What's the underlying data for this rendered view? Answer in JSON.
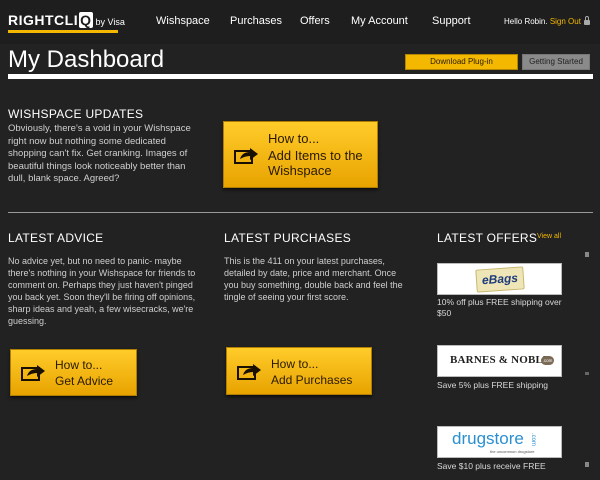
{
  "brand": {
    "logo_main": "RIGHTCLI",
    "logo_q": "Q",
    "logo_by": "by Visa"
  },
  "nav": {
    "items": [
      "Wishspace",
      "Purchases",
      "Offers",
      "My Account",
      "Support"
    ]
  },
  "user": {
    "greeting": "Hello Robin.",
    "sign_out": "Sign Out"
  },
  "header": {
    "title": "My Dashboard",
    "download_plugin": "Download Plug-in",
    "getting_started": "Getting Started"
  },
  "wishspace": {
    "heading": "WISHSPACE UPDATES",
    "body": "Obviously, there's a void in your Wishspace right now but nothing some dedicated shopping can't fix. Get cranking. Images of beautiful things look noticeably better than dull, blank space. Agreed?",
    "cta_line1": "How to...",
    "cta_line2": "Add Items to the Wishspace"
  },
  "advice": {
    "heading": "LATEST ADVICE",
    "body": "No advice yet, but no need to panic- maybe there's nothing in your Wishspace for friends to comment on. Perhaps they just haven't pinged you back yet. Soon they'll be firing off opinions, sharp ideas and yeah, a few wisecracks, we're guessing.",
    "cta_line1": "How to...",
    "cta_line2": "Get Advice"
  },
  "purchases": {
    "heading": "LATEST PURCHASES",
    "body": "This is the 411 on your latest purchases, detailed by date, price and merchant. Once you buy something, double back and feel the tingle of seeing your first score.",
    "cta_line1": "How to...",
    "cta_line2": "Add Purchases"
  },
  "offers": {
    "heading": "LATEST OFFERS",
    "view_all": "View all",
    "items": [
      {
        "brand": "eBags",
        "text": "10% off plus FREE shipping over $50"
      },
      {
        "brand": "BARNES & NOBLE",
        "brand_suffix": ".com",
        "text": "Save 5% plus FREE shipping"
      },
      {
        "brand": "drugstore",
        "brand_suffix": ".com",
        "tagline": "the uncommon drugstore",
        "text": "Save $10 plus receive FREE"
      }
    ]
  },
  "colors": {
    "accent": "#f5b800",
    "background": "#222222",
    "nav_bg": "#1e1e1e"
  }
}
